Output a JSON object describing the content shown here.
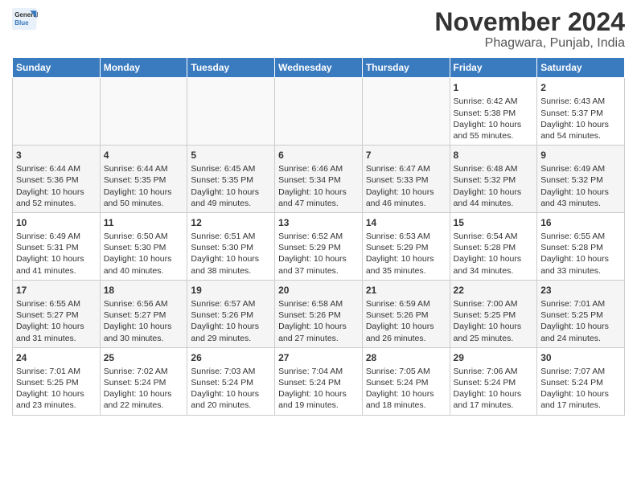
{
  "header": {
    "logo_line1": "General",
    "logo_line2": "Blue",
    "month": "November 2024",
    "location": "Phagwara, Punjab, India"
  },
  "days_of_week": [
    "Sunday",
    "Monday",
    "Tuesday",
    "Wednesday",
    "Thursday",
    "Friday",
    "Saturday"
  ],
  "weeks": [
    [
      {
        "day": "",
        "info": ""
      },
      {
        "day": "",
        "info": ""
      },
      {
        "day": "",
        "info": ""
      },
      {
        "day": "",
        "info": ""
      },
      {
        "day": "",
        "info": ""
      },
      {
        "day": "1",
        "info": "Sunrise: 6:42 AM\nSunset: 5:38 PM\nDaylight: 10 hours\nand 55 minutes."
      },
      {
        "day": "2",
        "info": "Sunrise: 6:43 AM\nSunset: 5:37 PM\nDaylight: 10 hours\nand 54 minutes."
      }
    ],
    [
      {
        "day": "3",
        "info": "Sunrise: 6:44 AM\nSunset: 5:36 PM\nDaylight: 10 hours\nand 52 minutes."
      },
      {
        "day": "4",
        "info": "Sunrise: 6:44 AM\nSunset: 5:35 PM\nDaylight: 10 hours\nand 50 minutes."
      },
      {
        "day": "5",
        "info": "Sunrise: 6:45 AM\nSunset: 5:35 PM\nDaylight: 10 hours\nand 49 minutes."
      },
      {
        "day": "6",
        "info": "Sunrise: 6:46 AM\nSunset: 5:34 PM\nDaylight: 10 hours\nand 47 minutes."
      },
      {
        "day": "7",
        "info": "Sunrise: 6:47 AM\nSunset: 5:33 PM\nDaylight: 10 hours\nand 46 minutes."
      },
      {
        "day": "8",
        "info": "Sunrise: 6:48 AM\nSunset: 5:32 PM\nDaylight: 10 hours\nand 44 minutes."
      },
      {
        "day": "9",
        "info": "Sunrise: 6:49 AM\nSunset: 5:32 PM\nDaylight: 10 hours\nand 43 minutes."
      }
    ],
    [
      {
        "day": "10",
        "info": "Sunrise: 6:49 AM\nSunset: 5:31 PM\nDaylight: 10 hours\nand 41 minutes."
      },
      {
        "day": "11",
        "info": "Sunrise: 6:50 AM\nSunset: 5:30 PM\nDaylight: 10 hours\nand 40 minutes."
      },
      {
        "day": "12",
        "info": "Sunrise: 6:51 AM\nSunset: 5:30 PM\nDaylight: 10 hours\nand 38 minutes."
      },
      {
        "day": "13",
        "info": "Sunrise: 6:52 AM\nSunset: 5:29 PM\nDaylight: 10 hours\nand 37 minutes."
      },
      {
        "day": "14",
        "info": "Sunrise: 6:53 AM\nSunset: 5:29 PM\nDaylight: 10 hours\nand 35 minutes."
      },
      {
        "day": "15",
        "info": "Sunrise: 6:54 AM\nSunset: 5:28 PM\nDaylight: 10 hours\nand 34 minutes."
      },
      {
        "day": "16",
        "info": "Sunrise: 6:55 AM\nSunset: 5:28 PM\nDaylight: 10 hours\nand 33 minutes."
      }
    ],
    [
      {
        "day": "17",
        "info": "Sunrise: 6:55 AM\nSunset: 5:27 PM\nDaylight: 10 hours\nand 31 minutes."
      },
      {
        "day": "18",
        "info": "Sunrise: 6:56 AM\nSunset: 5:27 PM\nDaylight: 10 hours\nand 30 minutes."
      },
      {
        "day": "19",
        "info": "Sunrise: 6:57 AM\nSunset: 5:26 PM\nDaylight: 10 hours\nand 29 minutes."
      },
      {
        "day": "20",
        "info": "Sunrise: 6:58 AM\nSunset: 5:26 PM\nDaylight: 10 hours\nand 27 minutes."
      },
      {
        "day": "21",
        "info": "Sunrise: 6:59 AM\nSunset: 5:26 PM\nDaylight: 10 hours\nand 26 minutes."
      },
      {
        "day": "22",
        "info": "Sunrise: 7:00 AM\nSunset: 5:25 PM\nDaylight: 10 hours\nand 25 minutes."
      },
      {
        "day": "23",
        "info": "Sunrise: 7:01 AM\nSunset: 5:25 PM\nDaylight: 10 hours\nand 24 minutes."
      }
    ],
    [
      {
        "day": "24",
        "info": "Sunrise: 7:01 AM\nSunset: 5:25 PM\nDaylight: 10 hours\nand 23 minutes."
      },
      {
        "day": "25",
        "info": "Sunrise: 7:02 AM\nSunset: 5:24 PM\nDaylight: 10 hours\nand 22 minutes."
      },
      {
        "day": "26",
        "info": "Sunrise: 7:03 AM\nSunset: 5:24 PM\nDaylight: 10 hours\nand 20 minutes."
      },
      {
        "day": "27",
        "info": "Sunrise: 7:04 AM\nSunset: 5:24 PM\nDaylight: 10 hours\nand 19 minutes."
      },
      {
        "day": "28",
        "info": "Sunrise: 7:05 AM\nSunset: 5:24 PM\nDaylight: 10 hours\nand 18 minutes."
      },
      {
        "day": "29",
        "info": "Sunrise: 7:06 AM\nSunset: 5:24 PM\nDaylight: 10 hours\nand 17 minutes."
      },
      {
        "day": "30",
        "info": "Sunrise: 7:07 AM\nSunset: 5:24 PM\nDaylight: 10 hours\nand 17 minutes."
      }
    ]
  ]
}
